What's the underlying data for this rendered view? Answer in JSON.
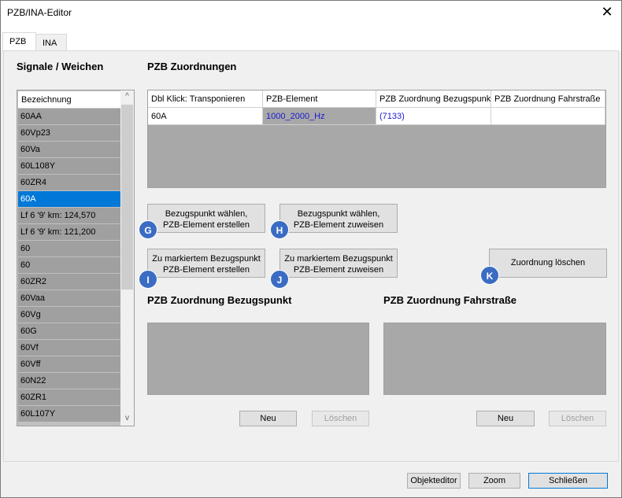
{
  "window": {
    "title": "PZB/INA-Editor",
    "close_glyph": "✕"
  },
  "tabs": [
    {
      "label": "PZB"
    },
    {
      "label": "INA"
    }
  ],
  "signals": {
    "title": "Signale / Weichen",
    "header": "Bezeichnung",
    "items": [
      {
        "label": "60AA"
      },
      {
        "label": "60Vp23"
      },
      {
        "label": "60Va"
      },
      {
        "label": "60L108Y"
      },
      {
        "label": "60ZR4"
      },
      {
        "label": "60A"
      },
      {
        "label": "Lf 6 '9' km: 124,570"
      },
      {
        "label": "Lf 6 '9' km: 121,200"
      },
      {
        "label": "60"
      },
      {
        "label": "60"
      },
      {
        "label": "60ZR2"
      },
      {
        "label": "60Vaa"
      },
      {
        "label": "60Vg"
      },
      {
        "label": "60G"
      },
      {
        "label": "60Vf"
      },
      {
        "label": "60Vff"
      },
      {
        "label": "60N22"
      },
      {
        "label": "60ZR1"
      },
      {
        "label": "60L107Y"
      }
    ],
    "selected_index": 5,
    "scroll_up": "^",
    "scroll_down": "v"
  },
  "zuordnungen": {
    "title": "PZB Zuordnungen",
    "columns": [
      "Dbl Klick: Transponieren",
      "PZB-Element",
      "PZB Zuordnung Bezugspunkt",
      "PZB Zuordnung Fahrstraße"
    ],
    "row": [
      "60A",
      "1000_2000_Hz",
      "(7133)",
      ""
    ]
  },
  "actions": {
    "g": {
      "line1": "Bezugspunkt wählen,",
      "line2": "PZB-Element erstellen",
      "badge": "G"
    },
    "h": {
      "line1": "Bezugspunkt wählen,",
      "line2": "PZB-Element zuweisen",
      "badge": "H"
    },
    "i": {
      "line1": "Zu markiertem Bezugspunkt",
      "line2": "PZB-Element erstellen",
      "badge": "I"
    },
    "j": {
      "line1": "Zu markiertem Bezugspunkt",
      "line2": "PZB-Element zuweisen",
      "badge": "J"
    },
    "k": {
      "label": "Zuordnung löschen",
      "badge": "K"
    }
  },
  "bezugspunkt": {
    "title": "PZB Zuordnung Bezugspunkt",
    "new_label": "Neu",
    "delete_label": "Löschen"
  },
  "fahrstrasse": {
    "title": "PZB Zuordnung Fahrstraße",
    "new_label": "Neu",
    "delete_label": "Löschen"
  },
  "footer": {
    "objekteditor": "Objekteditor",
    "zoom": "Zoom",
    "close": "Schließen"
  }
}
